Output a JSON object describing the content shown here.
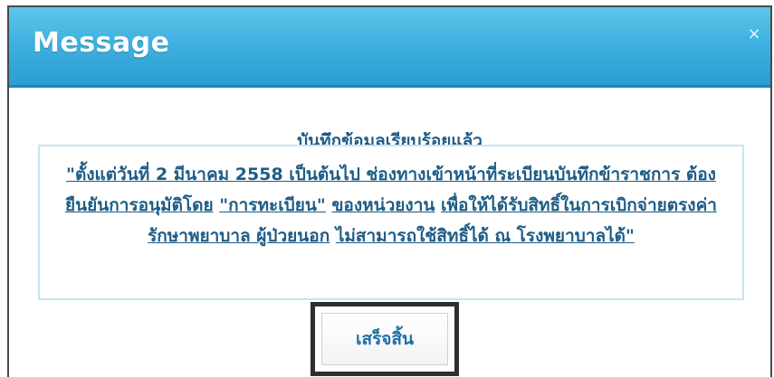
{
  "dialog": {
    "title": "Message",
    "close_glyph": "×",
    "heading": "บันทึกข้อมูลเรียบร้อยแล้ว",
    "notice": {
      "link_part_1": "\"ตั้งแต่วันที่ 2 มีนาคม 2558 เป็นต้นไป ช่องทางเข้าหน้าที่ระเบียนบันทึกข้าราชการ ต้องยืนยันการอนุมัติโดย",
      "quoted_part": "\"การทะเบียน\"",
      "link_part_2": "ของหน่วยงาน",
      "plain_part": "เพื่อให้ได้รับสิทธิ์ในการเบิกจ่ายตรงค่ารักษาพยาบาล ผู้ป่วยนอก",
      "link_part_3": "ไม่สามารถใช้สิทธิ์ได้ ณ โรงพยาบาลได้\""
    },
    "ok_label": "เสร็จสิ้น"
  },
  "colors": {
    "titlebar": "#3fb1e0",
    "text": "#1e5c86",
    "button_text": "#1e6fa8"
  },
  "icons": {
    "close": "close-icon"
  }
}
